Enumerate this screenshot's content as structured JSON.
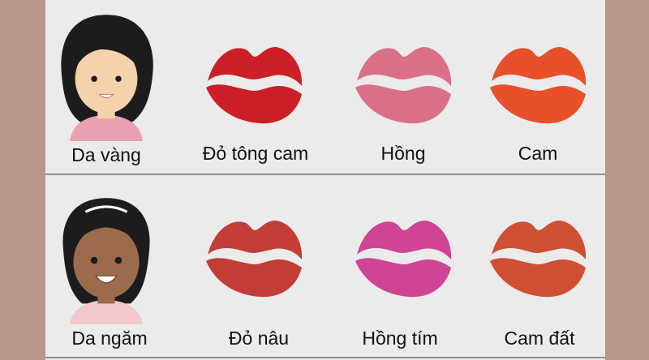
{
  "rows": [
    {
      "skin": {
        "label": "Da vàng",
        "skin_color": "#f6d2ac",
        "shirt_color": "#e9a0b0",
        "hair_color": "#1c1c1c"
      },
      "swatches": [
        {
          "label": "Đỏ tông cam",
          "color": "#cc1f27"
        },
        {
          "label": "Hồng",
          "color": "#da6f88"
        },
        {
          "label": "Cam",
          "color": "#e8502c"
        }
      ]
    },
    {
      "skin": {
        "label": "Da ngăm",
        "skin_color": "#9b6b4c",
        "shirt_color": "#f3c8cd",
        "hair_color": "#1c1c1c"
      },
      "swatches": [
        {
          "label": "Đỏ nâu",
          "color": "#c23d36"
        },
        {
          "label": "Hồng tím",
          "color": "#cf4494"
        },
        {
          "label": "Cam đất",
          "color": "#cf4f32"
        }
      ]
    }
  ]
}
